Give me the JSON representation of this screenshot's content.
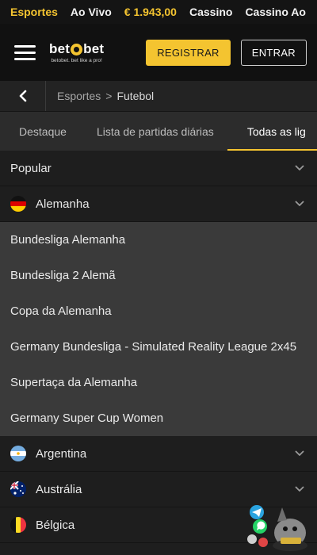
{
  "topnav": {
    "items": [
      "Esportes",
      "Ao Vivo",
      "€ 1.943,00",
      "Cassino",
      "Cassino Ao"
    ]
  },
  "header": {
    "logo_left": "bet",
    "logo_right": "bet",
    "logo_tagline": "betobet. bet like a pro!",
    "register_label": "REGISTRAR",
    "login_label": "ENTRAR"
  },
  "breadcrumb": {
    "items": [
      "Esportes",
      "Futebol"
    ],
    "separator": ">"
  },
  "tabs": [
    "Destaque",
    "Lista de partidas diárias",
    "Todas as lig"
  ],
  "sections": {
    "popular": "Popular",
    "germany": "Alemanha",
    "germany_leagues": [
      "Bundesliga Alemanha",
      "Bundesliga 2 Alemã",
      "Copa da Alemanha",
      "Germany Bundesliga - Simulated Reality League 2x45",
      "Supertaça da Alemanha",
      "Germany Super Cup Women"
    ],
    "argentina": "Argentina",
    "australia": "Austrália",
    "belgium": "Bélgica"
  },
  "colors": {
    "accent": "#f4c430",
    "background": "#1e1e1e",
    "expanded_background": "#3a3a3a"
  },
  "icons": {
    "menu": "hamburger-icon",
    "back": "chevron-left-icon",
    "expand": "chevron-down-icon",
    "chat": "telegram-whatsapp-chat-icon"
  }
}
